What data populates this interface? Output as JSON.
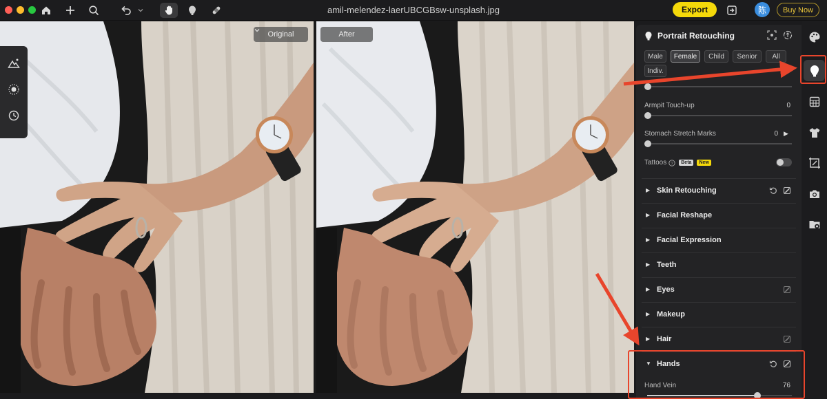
{
  "window": {
    "title": "amil-melendez-laerUBCGBsw-unsplash.jpg",
    "export_label": "Export",
    "avatar_text": "陈",
    "buy_now_label": "Buy Now",
    "traffic_colors": [
      "#ff5f57",
      "#febc2e",
      "#28c840"
    ]
  },
  "toolbar_icons": [
    "home-icon",
    "plus-icon",
    "search-icon",
    "undo-icon",
    "chevron-down-icon",
    "hand-icon",
    "portrait-icon",
    "bandage-icon",
    "import-icon"
  ],
  "canvas": {
    "original_label": "Original",
    "after_label": "After",
    "left_tools": [
      "landscape-ai-icon",
      "grain-icon",
      "history-icon"
    ]
  },
  "panel": {
    "title": "Portrait Retouching",
    "chips": [
      {
        "label": "Male",
        "selected": false
      },
      {
        "label": "Female",
        "selected": true
      },
      {
        "label": "Child",
        "selected": false
      },
      {
        "label": "Senior",
        "selected": false
      },
      {
        "label": "All",
        "selected": false
      },
      {
        "label": "Indiv.",
        "selected": false
      }
    ],
    "sliders": [
      {
        "label": "Armpit Touch-up",
        "value": "0"
      },
      {
        "label": "Stomach Stretch Marks",
        "value": "0"
      }
    ],
    "tattoos": {
      "label": "Tattoos",
      "beta": "Beta",
      "new": "New",
      "enabled": false
    },
    "sections": [
      {
        "label": "Skin Retouching",
        "expanded": false
      },
      {
        "label": "Facial Reshape",
        "expanded": false
      },
      {
        "label": "Facial Expression",
        "expanded": false
      },
      {
        "label": "Teeth",
        "expanded": false
      },
      {
        "label": "Eyes",
        "expanded": false
      },
      {
        "label": "Makeup",
        "expanded": false
      },
      {
        "label": "Hair",
        "expanded": false
      },
      {
        "label": "Hands",
        "expanded": true
      }
    ],
    "hands": {
      "label": "Hand Vein",
      "value": "76",
      "fraction": 0.76
    }
  },
  "right_tools": [
    "palette-icon",
    "face-icon",
    "layers-grid-icon",
    "tshirt-icon",
    "crop-icon",
    "camera-icon",
    "folder-eye-icon"
  ],
  "colors": {
    "accent_yellow": "#f5d90a",
    "annotation_red": "#e8452c",
    "beta_badge": "#d8d8d8",
    "new_badge": "#f5d90a"
  }
}
